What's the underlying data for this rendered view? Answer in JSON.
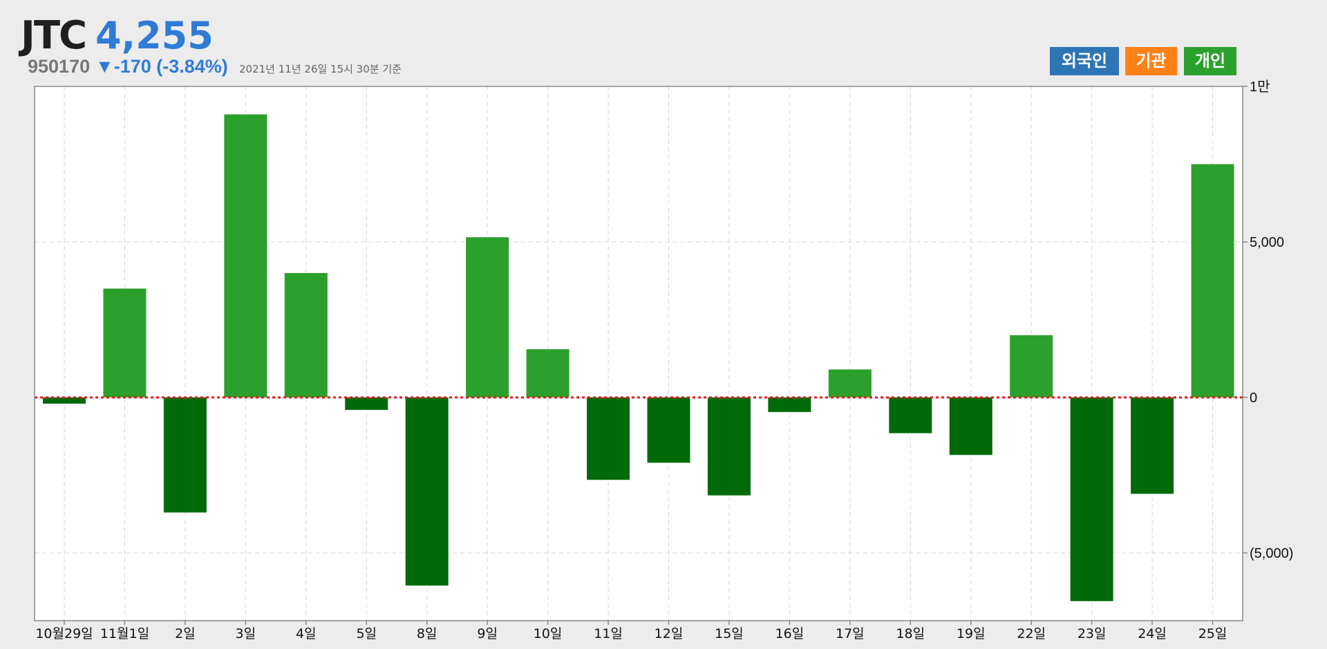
{
  "header": {
    "ticker": "JTC",
    "price": "4,255",
    "code": "950170",
    "change": "▼-170 (-3.84%)",
    "as_of": "2021년 11년 26일 15시 30분 기준"
  },
  "legend": [
    {
      "label": "외국인",
      "color": "#2e75b6"
    },
    {
      "label": "기관",
      "color": "#ff8219"
    },
    {
      "label": "개인",
      "color": "#2ca02c"
    }
  ],
  "colors": {
    "positive": "#2ca02c",
    "negative": "#006a0a",
    "zero_line": "#e8141e",
    "grid": "#d6d6d6",
    "axis": "#888888"
  },
  "chart_data": {
    "type": "bar",
    "categories": [
      "10월29일",
      "11월1일",
      "2일",
      "3일",
      "4일",
      "5일",
      "8일",
      "9일",
      "10일",
      "11일",
      "12일",
      "15일",
      "16일",
      "17일",
      "18일",
      "19일",
      "22일",
      "23일",
      "24일",
      "25일"
    ],
    "series": [
      {
        "name": "개인",
        "values": [
          -200,
          3500,
          -3700,
          9100,
          4000,
          -400,
          -6050,
          5150,
          1550,
          -2650,
          -2100,
          -3150,
          -470,
          900,
          -1150,
          -1850,
          2000,
          -6550,
          -3100,
          7500
        ]
      }
    ],
    "yticks": [
      {
        "value": 10000,
        "label": "1만"
      },
      {
        "value": 5000,
        "label": "5,000"
      },
      {
        "value": 0,
        "label": "0"
      },
      {
        "value": -5000,
        "label": "(5,000)"
      }
    ],
    "ylim": [
      -7300,
      10000
    ],
    "grid": true,
    "legend_position": "top-right",
    "zero_line": "dashed red"
  }
}
